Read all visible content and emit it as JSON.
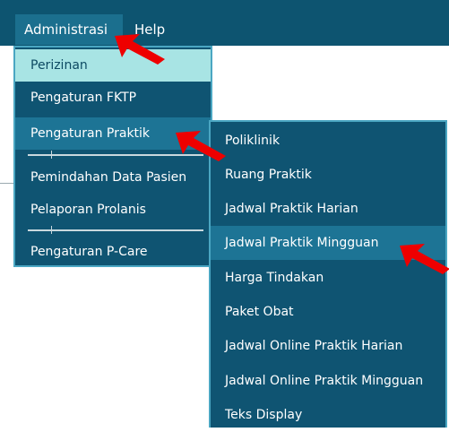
{
  "menubar": {
    "items": [
      "Administrasi",
      "Help"
    ]
  },
  "dropdown": {
    "items": [
      "Perizinan",
      "Pengaturan FKTP",
      "Pengaturan Praktik",
      "Pemindahan Data Pasien",
      "Pelaporan Prolanis",
      "Pengaturan P-Care"
    ]
  },
  "submenu": {
    "items": [
      "Poliklinik",
      "Ruang Praktik",
      "Jadwal Praktik Harian",
      "Jadwal Praktik Mingguan",
      "Harga Tindakan",
      "Paket Obat",
      "Jadwal Online Praktik Harian",
      "Jadwal Online Praktik Mingguan",
      "Teks Display"
    ]
  },
  "colors": {
    "menubar": "#0d5470",
    "menu_bg": "#0f5472",
    "active_item": "#1d7495",
    "hover_item": "#a8e4e4",
    "annotation_arrow": "#ee0000"
  },
  "icons": [
    "red-arrow-icon"
  ]
}
